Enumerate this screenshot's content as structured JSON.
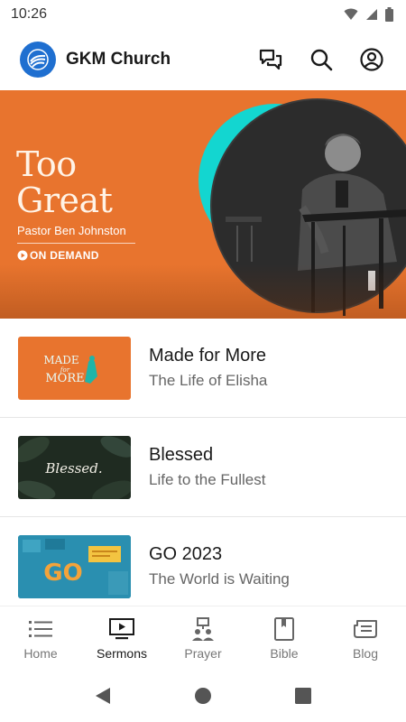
{
  "status_bar": {
    "time": "10:26",
    "icons": [
      "wifi-icon",
      "cell-signal-icon",
      "battery-icon"
    ]
  },
  "header": {
    "app_title": "GKM Church",
    "logo_color": "#1f6fd0",
    "actions": [
      "chat-icon",
      "search-icon",
      "account-icon"
    ]
  },
  "hero": {
    "title_line1": "Too",
    "title_line2": "Great",
    "speaker": "Pastor Ben Johnston",
    "badge": "ON DEMAND",
    "background_color": "#e8742e",
    "accent_color": "#13d6d0"
  },
  "sermons": [
    {
      "title": "Made for More",
      "subtitle": "The Life of Elisha",
      "thumb_text": "MADE for MORE"
    },
    {
      "title": "Blessed",
      "subtitle": "Life to the Fullest",
      "thumb_text": "Blessed."
    },
    {
      "title": "GO 2023",
      "subtitle": "The World is Waiting",
      "thumb_text": "GO"
    }
  ],
  "bottom_nav": {
    "active": "Sermons",
    "items": [
      {
        "label": "Home",
        "icon": "list-icon"
      },
      {
        "label": "Sermons",
        "icon": "tv-play-icon"
      },
      {
        "label": "Prayer",
        "icon": "prayer-icon"
      },
      {
        "label": "Bible",
        "icon": "bible-icon"
      },
      {
        "label": "Blog",
        "icon": "blog-icon"
      }
    ]
  },
  "system_nav": [
    "back-icon",
    "home-circle-icon",
    "recents-icon"
  ]
}
